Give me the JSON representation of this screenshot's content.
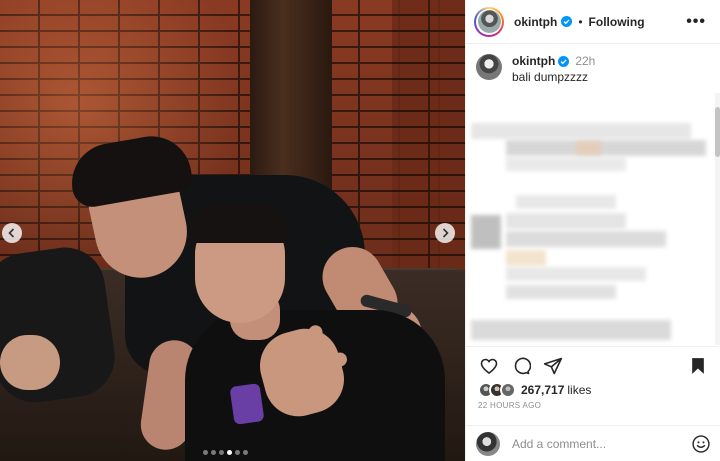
{
  "post": {
    "username": "okintph",
    "verified": true,
    "separator": "•",
    "follow_status": "Following",
    "more_icon": "more-horizontal-icon"
  },
  "caption": {
    "username": "okintph",
    "time": "22h",
    "text": "bali dumpzzzz"
  },
  "carousel": {
    "prev_icon": "chevron-left-icon",
    "next_icon": "chevron-right-icon",
    "total_dots": 6,
    "active_dot": 4
  },
  "actions": {
    "like_icon": "heart-icon",
    "comment_icon": "comment-icon",
    "share_icon": "send-icon",
    "save_icon": "bookmark-icon"
  },
  "likes": {
    "count": "267,717",
    "label": "likes"
  },
  "time_ago": "22 HOURS AGO",
  "add_comment": {
    "placeholder": "Add a comment...",
    "emoji_icon": "smiley-icon"
  },
  "colors": {
    "verified_blue": "#0095f6",
    "text": "#262626",
    "muted": "#8e8e8e"
  }
}
